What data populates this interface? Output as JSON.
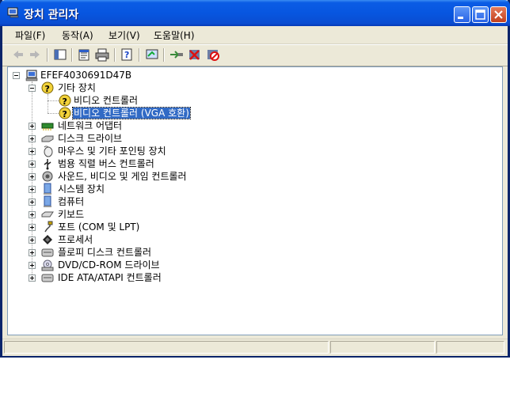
{
  "window": {
    "title": "장치 관리자"
  },
  "menu": [
    "파일(F)",
    "동작(A)",
    "보기(V)",
    "도움말(H)"
  ],
  "toolbar_icons": [
    "back-icon",
    "forward-icon",
    "show-hide-tree-icon",
    "properties-icon",
    "print-icon",
    "help-icon",
    "scan-hardware-icon",
    "update-driver-icon",
    "uninstall-icon",
    "disable-icon"
  ],
  "tree": {
    "root": "EFEF4030691D47B",
    "nodes": [
      {
        "label": "기타 장치",
        "icon": "unknown-device-icon",
        "expanded": true,
        "children": [
          {
            "label": "비디오 컨트롤러",
            "icon": "warning-device-icon"
          },
          {
            "label": "비디오 컨트롤러 (VGA 호환)",
            "icon": "warning-device-icon",
            "selected": true
          }
        ]
      },
      {
        "label": "네트워크 어댑터",
        "icon": "network-adapter-icon"
      },
      {
        "label": "디스크 드라이브",
        "icon": "disk-drive-icon"
      },
      {
        "label": "마우스 및 기타 포인팅 장치",
        "icon": "mouse-icon"
      },
      {
        "label": "범용 직렬 버스 컨트롤러",
        "icon": "usb-icon"
      },
      {
        "label": "사운드, 비디오 및 게임 컨트롤러",
        "icon": "sound-icon"
      },
      {
        "label": "시스템 장치",
        "icon": "system-device-icon"
      },
      {
        "label": "컴퓨터",
        "icon": "computer-icon"
      },
      {
        "label": "키보드",
        "icon": "keyboard-icon"
      },
      {
        "label": "포트 (COM 및 LPT)",
        "icon": "port-icon"
      },
      {
        "label": "프로세서",
        "icon": "processor-icon"
      },
      {
        "label": "플로피 디스크 컨트롤러",
        "icon": "floppy-controller-icon"
      },
      {
        "label": "DVD/CD-ROM 드라이브",
        "icon": "cdrom-icon"
      },
      {
        "label": "IDE ATA/ATAPI 컨트롤러",
        "icon": "ide-controller-icon"
      }
    ]
  }
}
